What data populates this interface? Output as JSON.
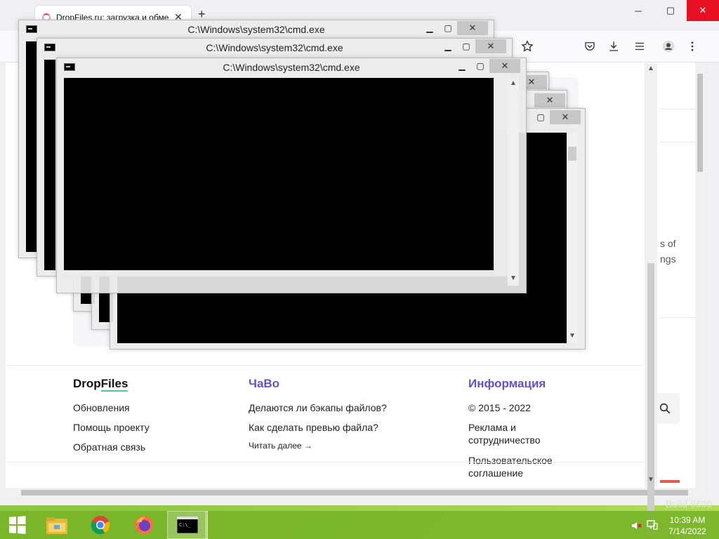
{
  "browser": {
    "tab_title": "DropFiles.ru: загрузка и обмен",
    "tab_close": "✕",
    "new_tab": "+",
    "side_texts": [
      "s of",
      "ngs"
    ],
    "icons": [
      "bookmark-star-icon",
      "pocket-icon",
      "download-icon",
      "menu-icon",
      "account-icon",
      "more-icon"
    ]
  },
  "site": {
    "logo_part1": "Drop",
    "logo_part2": "Files",
    "col1": {
      "links": [
        "Обновления",
        "Помощь проекту",
        "Обратная связь"
      ]
    },
    "col2": {
      "title": "ЧаВо",
      "links": [
        "Делаются ли бэкапы файлов?",
        "Как сделать превью файла?"
      ],
      "more": "Читать далее →"
    },
    "col3": {
      "title": "Информация",
      "copyright": "© 2015 - 2022",
      "links": [
        "Реклама и",
        "сотрудничество",
        "Пользовательское",
        "соглашение"
      ]
    },
    "accent_title": "#6a4fc9"
  },
  "cmd": {
    "title": "C:\\Windows\\system32\\cmd.exe",
    "min": "▁",
    "max": "▢",
    "close": "✕"
  },
  "desktop": {
    "build": "Build 9600"
  },
  "taskbar": {
    "time": "10:39 AM",
    "date": "7/14/2022"
  }
}
